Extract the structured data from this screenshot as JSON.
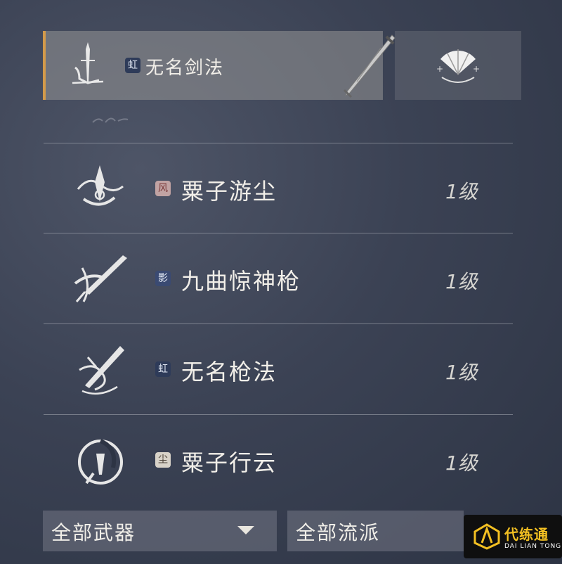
{
  "selected_skill": {
    "badge": "虹",
    "name": "无名剑法",
    "badge_color": "#2e3b59",
    "accent_color": "#d39a4a",
    "icon": "sword-stance-icon",
    "weapon_icon": "sword-icon"
  },
  "side_button": {
    "icon": "fan-icon"
  },
  "skills": [
    {
      "badge": "风",
      "badge_color": "#c1a3a3",
      "badge_text_color": "#7a3a3a",
      "name": "粟子游尘",
      "level": "1级",
      "icon": "whirl-blade-icon"
    },
    {
      "badge": "影",
      "badge_color": "#3a4a72",
      "badge_text_color": "#dfe6f2",
      "name": "九曲惊神枪",
      "level": "1级",
      "icon": "spear-slash-icon"
    },
    {
      "badge": "虹",
      "badge_color": "#2e3b59",
      "badge_text_color": "#dfe6f2",
      "name": "无名枪法",
      "level": "1级",
      "icon": "spear-sweep-icon"
    },
    {
      "badge": "尘",
      "badge_color": "#d8d2c8",
      "badge_text_color": "#4a4036",
      "name": "粟子行云",
      "level": "1级",
      "icon": "spiral-blade-icon"
    }
  ],
  "filters": {
    "weapon": {
      "label": "全部武器",
      "icon": "dropdown-arrow-icon"
    },
    "school": {
      "label": "全部流派"
    }
  },
  "watermark": {
    "title": "代练通",
    "subtitle": "DAI LIAN TONG"
  }
}
